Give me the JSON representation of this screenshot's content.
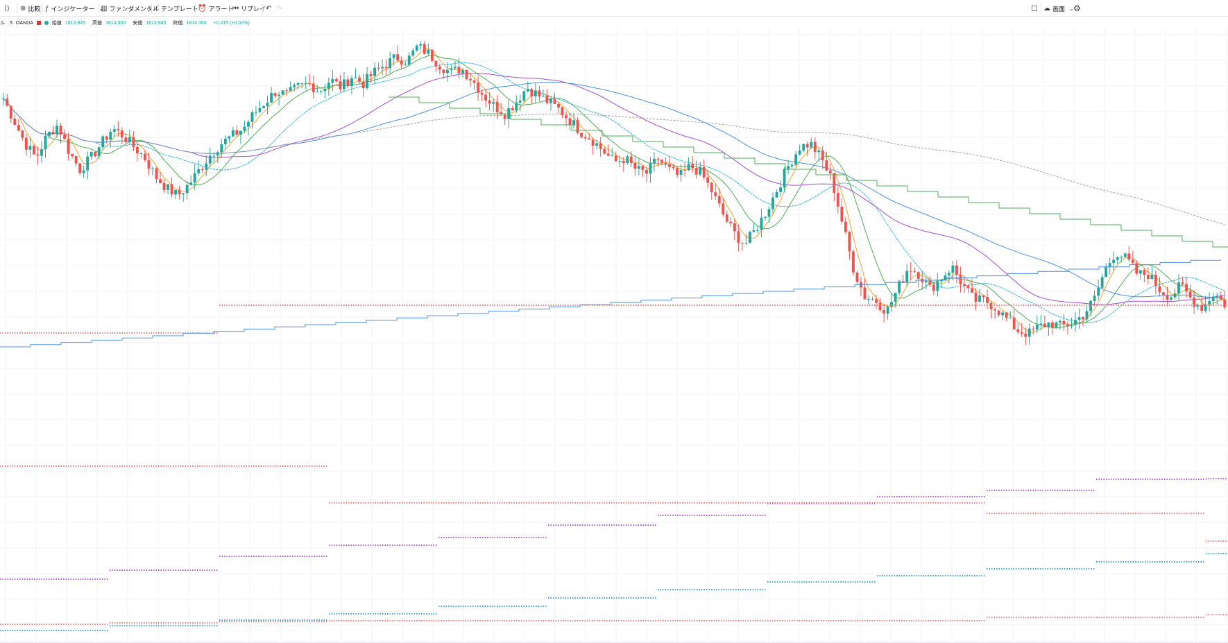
{
  "toolbar": {
    "symbol_icon": "symbol-compare-icon",
    "compare_label": "比較",
    "indicators_label": "インジケーター",
    "fundamentals_label": "ファンダメンタル",
    "templates_label": "テンプレート",
    "alert_label": "アラート",
    "replay_label": "リプレイ",
    "undo_icon": "undo-icon",
    "redo_icon": "redo-icon",
    "fullscreen_icon": "fullscreen-icon",
    "layout_label": "画面",
    "settings_icon": "gear-icon"
  },
  "legend": {
    "symbol_fragment": "ル",
    "interval": "5",
    "exchange": "OANDA",
    "open_label": "始値",
    "open_value": "1813.945",
    "high_label": "高値",
    "high_value": "1814.360",
    "low_label": "安値",
    "low_value": "1813.945",
    "close_label": "終値",
    "close_value": "1814.360",
    "change": "+0.415 (+0.02%)"
  },
  "colors": {
    "up": "#26a69a",
    "down": "#ef5350",
    "ma_orange": "#f5a623",
    "ma_green": "#4caf50",
    "ma_cyan": "#2ab6d6",
    "ma_purple": "#a64ccf",
    "ma_blue": "#4a90e2",
    "ma_gray": "#9e9e9e",
    "level_red": "#f08080",
    "level_purple": "#b854d4",
    "level_blue": "#3aa8d8"
  },
  "chart_data": {
    "type": "candlestick",
    "instrument": "OANDA",
    "interval": "5",
    "close_profile": [
      1822,
      1816,
      1810,
      1806,
      1812,
      1815,
      1808,
      1803,
      1806,
      1810,
      1814,
      1812,
      1809,
      1806,
      1801,
      1798,
      1796,
      1799,
      1803,
      1807,
      1810,
      1812,
      1814,
      1818,
      1821,
      1824,
      1823,
      1825,
      1826,
      1824,
      1827,
      1825,
      1828,
      1826,
      1829,
      1831,
      1833,
      1832,
      1836,
      1834,
      1831,
      1829,
      1830,
      1827,
      1823,
      1820,
      1818,
      1821,
      1825,
      1823,
      1821,
      1819,
      1816,
      1813,
      1811,
      1808,
      1805,
      1806,
      1803,
      1802,
      1806,
      1803,
      1801,
      1804,
      1802,
      1797,
      1791,
      1786,
      1783,
      1787,
      1792,
      1798,
      1804,
      1809,
      1810,
      1806,
      1800,
      1788,
      1776,
      1769,
      1768,
      1765,
      1771,
      1777,
      1775,
      1771,
      1774,
      1777,
      1772,
      1768,
      1768,
      1766,
      1763,
      1760,
      1759,
      1761,
      1762,
      1761,
      1762,
      1764,
      1768,
      1776,
      1781,
      1779,
      1775,
      1775,
      1771,
      1769,
      1772,
      1768,
      1766,
      1770,
      1767
    ]
  }
}
